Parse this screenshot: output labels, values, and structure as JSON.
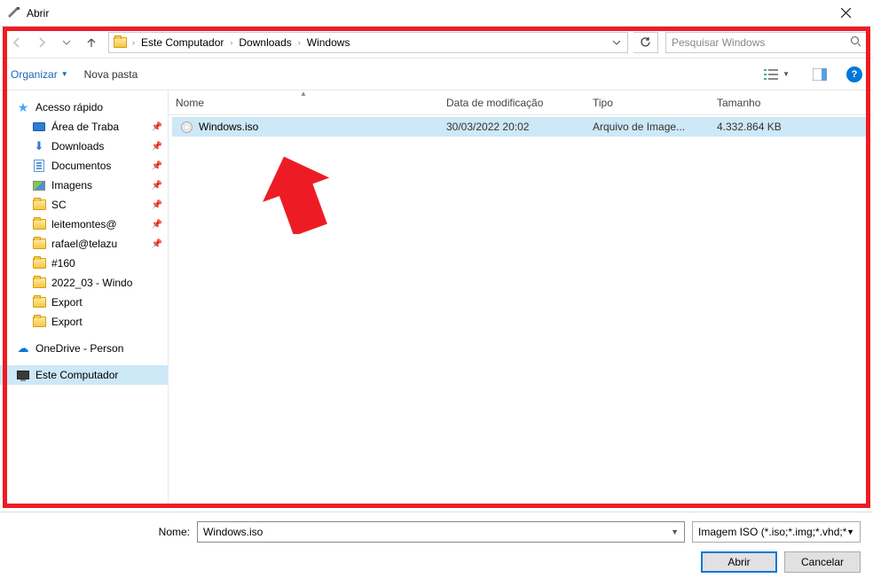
{
  "window": {
    "title": "Abrir"
  },
  "breadcrumb": {
    "items": [
      "Este Computador",
      "Downloads",
      "Windows"
    ]
  },
  "search": {
    "placeholder": "Pesquisar Windows"
  },
  "toolbar": {
    "organize": "Organizar",
    "new_folder": "Nova pasta"
  },
  "columns": {
    "name": "Nome",
    "date": "Data de modificação",
    "type": "Tipo",
    "size": "Tamanho"
  },
  "sidebar": {
    "quick_access": "Acesso rápido",
    "items": [
      "Área de Traba",
      "Downloads",
      "Documentos",
      "Imagens",
      "SC",
      "leitemontes@",
      "rafael@telazu",
      "#160",
      "2022_03 - Windo",
      "Export",
      "Export"
    ],
    "onedrive": "OneDrive - Person",
    "this_pc": "Este Computador"
  },
  "files": [
    {
      "name": "Windows.iso",
      "date": "30/03/2022 20:02",
      "type": "Arquivo de Image...",
      "size": "4.332.864 KB"
    }
  ],
  "footer": {
    "name_label": "Nome:",
    "filename": "Windows.iso",
    "filter": "Imagem ISO (*.iso;*.img;*.vhd;*",
    "open": "Abrir",
    "cancel": "Cancelar"
  }
}
